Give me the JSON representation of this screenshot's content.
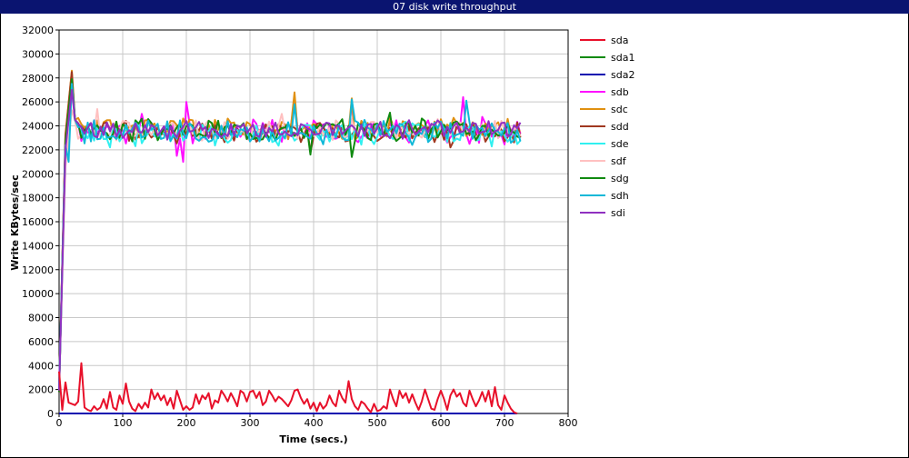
{
  "window": {
    "title": "07 disk write throughput"
  },
  "chart_data": {
    "type": "line",
    "title": "07 disk write throughput",
    "xlabel": "Time (secs.)",
    "ylabel": "Write KBytes/sec",
    "xlim": [
      0,
      800
    ],
    "ylim": [
      0,
      32000
    ],
    "x_ticks": [
      0,
      100,
      200,
      300,
      400,
      500,
      600,
      700,
      800
    ],
    "y_ticks": [
      0,
      2000,
      4000,
      6000,
      8000,
      10000,
      12000,
      14000,
      16000,
      18000,
      20000,
      22000,
      24000,
      26000,
      28000,
      30000,
      32000
    ],
    "grid": true,
    "legend_position": "right",
    "series": [
      {
        "name": "sda",
        "color": "#e8102a",
        "points": [
          [
            0,
            3500
          ],
          [
            5,
            300
          ],
          [
            10,
            2600
          ],
          [
            15,
            900
          ],
          [
            20,
            800
          ],
          [
            25,
            700
          ],
          [
            30,
            1000
          ],
          [
            35,
            4200
          ],
          [
            40,
            500
          ],
          [
            45,
            300
          ],
          [
            50,
            200
          ],
          [
            55,
            600
          ],
          [
            60,
            300
          ],
          [
            65,
            500
          ],
          [
            70,
            1200
          ],
          [
            75,
            400
          ],
          [
            80,
            1800
          ],
          [
            85,
            500
          ],
          [
            90,
            300
          ],
          [
            95,
            1500
          ],
          [
            100,
            800
          ],
          [
            105,
            2500
          ],
          [
            110,
            1000
          ],
          [
            115,
            400
          ],
          [
            120,
            200
          ],
          [
            125,
            800
          ],
          [
            130,
            400
          ],
          [
            135,
            900
          ],
          [
            140,
            500
          ],
          [
            145,
            2000
          ],
          [
            150,
            1200
          ],
          [
            155,
            1700
          ],
          [
            160,
            1100
          ],
          [
            165,
            1500
          ],
          [
            170,
            700
          ],
          [
            175,
            1300
          ],
          [
            180,
            400
          ],
          [
            185,
            1900
          ],
          [
            190,
            1100
          ],
          [
            195,
            300
          ],
          [
            200,
            600
          ],
          [
            205,
            300
          ],
          [
            210,
            500
          ],
          [
            215,
            1600
          ],
          [
            220,
            800
          ],
          [
            225,
            1500
          ],
          [
            230,
            1200
          ],
          [
            235,
            1700
          ],
          [
            240,
            400
          ],
          [
            245,
            1100
          ],
          [
            250,
            900
          ],
          [
            255,
            1900
          ],
          [
            260,
            1500
          ],
          [
            265,
            1000
          ],
          [
            270,
            1700
          ],
          [
            275,
            1200
          ],
          [
            280,
            600
          ],
          [
            285,
            1900
          ],
          [
            290,
            1700
          ],
          [
            295,
            1000
          ],
          [
            300,
            1800
          ],
          [
            305,
            1900
          ],
          [
            310,
            1300
          ],
          [
            315,
            1800
          ],
          [
            320,
            700
          ],
          [
            325,
            1000
          ],
          [
            330,
            1900
          ],
          [
            335,
            1500
          ],
          [
            340,
            1000
          ],
          [
            345,
            1400
          ],
          [
            350,
            1200
          ],
          [
            355,
            900
          ],
          [
            360,
            600
          ],
          [
            365,
            1100
          ],
          [
            370,
            1900
          ],
          [
            375,
            2000
          ],
          [
            380,
            1300
          ],
          [
            385,
            800
          ],
          [
            390,
            1200
          ],
          [
            395,
            400
          ],
          [
            400,
            900
          ],
          [
            405,
            200
          ],
          [
            410,
            900
          ],
          [
            415,
            400
          ],
          [
            420,
            700
          ],
          [
            425,
            1500
          ],
          [
            430,
            900
          ],
          [
            435,
            600
          ],
          [
            440,
            1900
          ],
          [
            445,
            1300
          ],
          [
            450,
            900
          ],
          [
            455,
            2700
          ],
          [
            460,
            1200
          ],
          [
            465,
            600
          ],
          [
            470,
            300
          ],
          [
            475,
            1000
          ],
          [
            480,
            800
          ],
          [
            485,
            400
          ],
          [
            490,
            100
          ],
          [
            495,
            800
          ],
          [
            500,
            200
          ],
          [
            505,
            300
          ],
          [
            510,
            600
          ],
          [
            515,
            400
          ],
          [
            520,
            2000
          ],
          [
            525,
            1200
          ],
          [
            530,
            600
          ],
          [
            535,
            1900
          ],
          [
            540,
            1300
          ],
          [
            545,
            1700
          ],
          [
            550,
            900
          ],
          [
            555,
            1600
          ],
          [
            560,
            900
          ],
          [
            565,
            300
          ],
          [
            570,
            1000
          ],
          [
            575,
            2000
          ],
          [
            580,
            1200
          ],
          [
            585,
            400
          ],
          [
            590,
            300
          ],
          [
            595,
            1200
          ],
          [
            600,
            1900
          ],
          [
            605,
            1200
          ],
          [
            610,
            300
          ],
          [
            615,
            1500
          ],
          [
            620,
            2000
          ],
          [
            625,
            1400
          ],
          [
            630,
            1700
          ],
          [
            635,
            900
          ],
          [
            640,
            600
          ],
          [
            645,
            1900
          ],
          [
            650,
            1200
          ],
          [
            655,
            600
          ],
          [
            660,
            1100
          ],
          [
            665,
            1800
          ],
          [
            670,
            1000
          ],
          [
            675,
            1900
          ],
          [
            680,
            600
          ],
          [
            685,
            2200
          ],
          [
            690,
            700
          ],
          [
            695,
            300
          ],
          [
            700,
            1500
          ],
          [
            705,
            900
          ],
          [
            710,
            400
          ],
          [
            715,
            100
          ],
          [
            720,
            0
          ]
        ]
      },
      {
        "name": "sda1",
        "color": "#0b8a0b",
        "points": [
          [
            0,
            0
          ],
          [
            720,
            0
          ]
        ]
      },
      {
        "name": "sda2",
        "color": "#0a0ab0",
        "points": [
          [
            0,
            0
          ],
          [
            720,
            0
          ]
        ]
      },
      {
        "name": "sdb",
        "color": "#ff10ff",
        "base": 23600,
        "amp": 900,
        "seed": 11,
        "start": 2000,
        "peak": 27800,
        "spikes": [
          [
            130,
            25000
          ],
          [
            185,
            21500
          ],
          [
            195,
            21000
          ],
          [
            200,
            26000
          ],
          [
            370,
            26300
          ],
          [
            460,
            26000
          ],
          [
            635,
            26400
          ],
          [
            645,
            22500
          ]
        ]
      },
      {
        "name": "sdc",
        "color": "#e09010",
        "base": 23800,
        "amp": 800,
        "seed": 23,
        "start": 2000,
        "peak": 28600,
        "spikes": [
          [
            370,
            26800
          ],
          [
            460,
            26300
          ]
        ]
      },
      {
        "name": "sdd",
        "color": "#a03820",
        "base": 23500,
        "amp": 800,
        "seed": 37,
        "start": 1800,
        "peak": 28500,
        "spikes": [
          [
            395,
            21800
          ],
          [
            615,
            22200
          ]
        ]
      },
      {
        "name": "sde",
        "color": "#30f0f0",
        "base": 23300,
        "amp": 900,
        "seed": 41,
        "start": 1900,
        "peak": 27400,
        "spikes": [
          [
            80,
            22200
          ],
          [
            120,
            22300
          ]
        ]
      },
      {
        "name": "sdf",
        "color": "#ffc0c0",
        "base": 23600,
        "amp": 800,
        "seed": 53,
        "start": 1900,
        "peak": 25300,
        "spikes": [
          [
            60,
            25400
          ],
          [
            350,
            25000
          ]
        ]
      },
      {
        "name": "sdg",
        "color": "#108a10",
        "base": 23700,
        "amp": 800,
        "seed": 67,
        "start": 1800,
        "peak": 27900,
        "spikes": [
          [
            395,
            21600
          ],
          [
            460,
            21400
          ],
          [
            520,
            25100
          ]
        ]
      },
      {
        "name": "sdh",
        "color": "#10b8d8",
        "base": 23500,
        "amp": 900,
        "seed": 79,
        "start": 2000,
        "peak": 27500,
        "spikes": [
          [
            15,
            21000
          ],
          [
            370,
            25800
          ],
          [
            460,
            26200
          ],
          [
            640,
            26100
          ]
        ]
      },
      {
        "name": "sdi",
        "color": "#9030c0",
        "base": 23700,
        "amp": 700,
        "seed": 97,
        "start": 1900,
        "peak": 27000,
        "spikes": []
      }
    ]
  }
}
